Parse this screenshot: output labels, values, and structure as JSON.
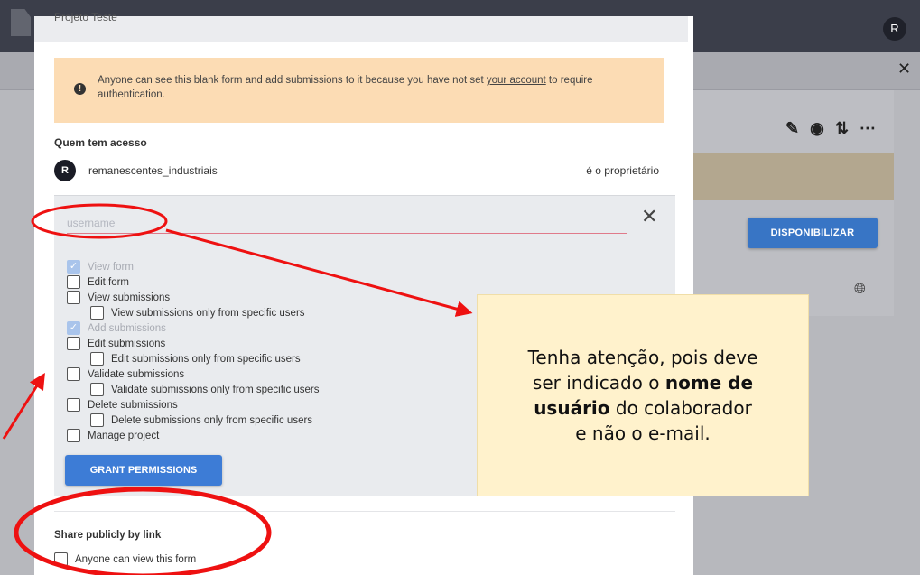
{
  "app": {
    "avatar_initial": "R",
    "publish_button": "DISPONIBILIZAR",
    "close_glyph": "✕"
  },
  "modal": {
    "title": "Projeto Teste",
    "warning": {
      "prefix": "Anyone can see this blank form and add submissions to it because you have not set ",
      "link": "your account",
      "suffix": " to require authentication."
    },
    "who_has_access": "Quem tem acesso",
    "owner": {
      "initial": "R",
      "username": "remanescentes_industriais",
      "role": "é o proprietário"
    },
    "username_placeholder": "username",
    "permissions": [
      {
        "label": "View form",
        "checked": true,
        "disabled": true,
        "sub": false
      },
      {
        "label": "Edit form",
        "checked": false,
        "disabled": false,
        "sub": false
      },
      {
        "label": "View submissions",
        "checked": false,
        "disabled": false,
        "sub": false
      },
      {
        "label": "View submissions only from specific users",
        "checked": false,
        "disabled": false,
        "sub": true
      },
      {
        "label": "Add submissions",
        "checked": true,
        "disabled": true,
        "sub": false
      },
      {
        "label": "Edit submissions",
        "checked": false,
        "disabled": false,
        "sub": false
      },
      {
        "label": "Edit submissions only from specific users",
        "checked": false,
        "disabled": false,
        "sub": true
      },
      {
        "label": "Validate submissions",
        "checked": false,
        "disabled": false,
        "sub": false
      },
      {
        "label": "Validate submissions only from specific users",
        "checked": false,
        "disabled": false,
        "sub": true
      },
      {
        "label": "Delete submissions",
        "checked": false,
        "disabled": false,
        "sub": false
      },
      {
        "label": "Delete submissions only from specific users",
        "checked": false,
        "disabled": false,
        "sub": true
      },
      {
        "label": "Manage project",
        "checked": false,
        "disabled": false,
        "sub": false
      }
    ],
    "grant_button": "GRANT PERMISSIONS",
    "share_title": "Share publicly by link",
    "share_option": "Anyone can view this form"
  },
  "annotation": {
    "line1": "Tenha atenção, pois deve",
    "line2_pre": "ser indicado o ",
    "line2_bold": "nome de",
    "line3_bold": "usuário",
    "line3_post": " do colaborador",
    "line4": "e não o e-mail."
  },
  "colors": {
    "accent_blue": "#3d7cd6",
    "warning_bg": "#fcdcb4",
    "annotation_red": "#ee1111",
    "note_bg": "#fff2cc"
  }
}
